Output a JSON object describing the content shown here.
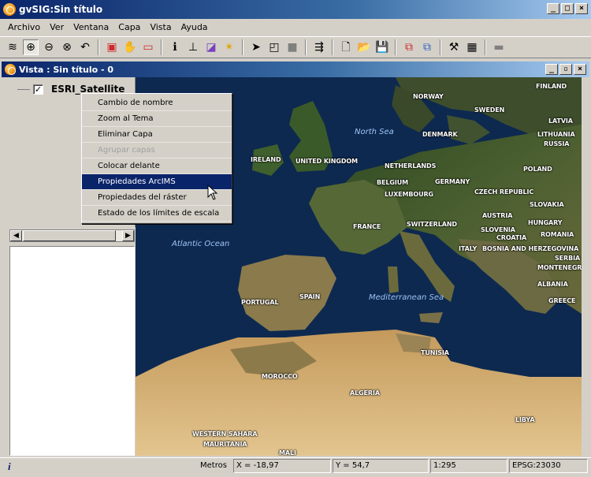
{
  "app": {
    "title": "gvSIG:Sin título"
  },
  "window_buttons": {
    "minimize": "_",
    "maximize": "□",
    "close": "×",
    "restore": "▫"
  },
  "menubar": [
    {
      "label": "Archivo"
    },
    {
      "label": "Ver"
    },
    {
      "label": "Ventana"
    },
    {
      "label": "Capa"
    },
    {
      "label": "Vista"
    },
    {
      "label": "Ayuda"
    }
  ],
  "toolbar": [
    {
      "icon": "layers-icon",
      "glyph": "≋"
    },
    {
      "icon": "zoom-in-icon",
      "glyph": "⊕",
      "active": true
    },
    {
      "icon": "zoom-out-icon",
      "glyph": "⊖"
    },
    {
      "icon": "zoom-full-icon",
      "glyph": "⊗"
    },
    {
      "icon": "zoom-back-icon",
      "glyph": "↶"
    },
    {
      "sep": true
    },
    {
      "icon": "zoom-layer-icon",
      "glyph": "▣",
      "color": "#cc2a2a"
    },
    {
      "icon": "pan-icon",
      "glyph": "✋"
    },
    {
      "icon": "select-rect-icon",
      "glyph": "▭",
      "color": "#cc2a2a"
    },
    {
      "sep": true
    },
    {
      "icon": "info-icon",
      "glyph": "ℹ"
    },
    {
      "icon": "measure-distance-icon",
      "glyph": "⊥"
    },
    {
      "icon": "measure-area-icon",
      "glyph": "◪",
      "color": "#7a3fbf"
    },
    {
      "icon": "locate-icon",
      "glyph": "✴",
      "color": "#e0a000"
    },
    {
      "sep": true
    },
    {
      "icon": "select-pointer-icon",
      "glyph": "➤"
    },
    {
      "icon": "select-point-icon",
      "glyph": "◰"
    },
    {
      "icon": "select-square-icon",
      "glyph": "■",
      "color": "#808080"
    },
    {
      "sep": true
    },
    {
      "icon": "expand-icon",
      "glyph": "⇶"
    },
    {
      "sep": true
    },
    {
      "icon": "new-icon",
      "glyph": "🗋"
    },
    {
      "icon": "open-icon",
      "glyph": "📂"
    },
    {
      "icon": "save-icon",
      "glyph": "💾"
    },
    {
      "sep": true
    },
    {
      "icon": "copy-icon",
      "glyph": "⧉",
      "color": "#cc2a2a"
    },
    {
      "icon": "paste-icon",
      "glyph": "⧉",
      "color": "#3060c0"
    },
    {
      "sep": true
    },
    {
      "icon": "tools-icon",
      "glyph": "⚒"
    },
    {
      "icon": "table-icon",
      "glyph": "▦"
    },
    {
      "sep": true
    },
    {
      "icon": "extra-icon",
      "glyph": "▬",
      "color": "#808080"
    }
  ],
  "view": {
    "title": "Vista : Sin título - 0"
  },
  "toc": {
    "layer_name": "ESRI_Satellite",
    "checked": "✓"
  },
  "context_menu": [
    {
      "label": "Cambio de nombre"
    },
    {
      "label": "Zoom al Tema"
    },
    {
      "label": "Eliminar Capa"
    },
    {
      "label": "Agrupar capas",
      "disabled": true
    },
    {
      "label": "Colocar delante"
    },
    {
      "label": "Propiedades ArcIMS",
      "selected": true
    },
    {
      "label": "Propiedades del ráster"
    },
    {
      "label": "Estado de los límites de escala"
    }
  ],
  "map": {
    "seas": [
      "North Sea",
      "Atlantic Ocean",
      "Mediterranean Sea"
    ],
    "countries": [
      "FINLAND",
      "NORWAY",
      "SWEDEN",
      "DENMARK",
      "LATVIA",
      "LITHUANIA",
      "RUSSIA",
      "IRELAND",
      "UNITED KINGDOM",
      "NETHERLANDS",
      "POLAND",
      "BELGIUM",
      "GERMANY",
      "LUXEMBOURG",
      "CZECH REPUBLIC",
      "SLOVAKIA",
      "AUSTRIA",
      "HUNGARY",
      "FRANCE",
      "SWITZERLAND",
      "SLOVENIA",
      "CROATIA",
      "ROMANIA",
      "ITALY",
      "BOSNIA AND HERZEGOVINA",
      "SERBIA",
      "MONTENEGRO",
      "ALBANIA",
      "GREECE",
      "PORTUGAL",
      "SPAIN",
      "TUNISIA",
      "MOROCCO",
      "ALGERIA",
      "LIBYA",
      "WESTERN SAHARA",
      "MAURITANIA",
      "MALI"
    ]
  },
  "status": {
    "units": "Metros",
    "x": "X = -18,97",
    "y": "Y = 54,7",
    "scale": "1:295",
    "crs": "EPSG:23030"
  }
}
